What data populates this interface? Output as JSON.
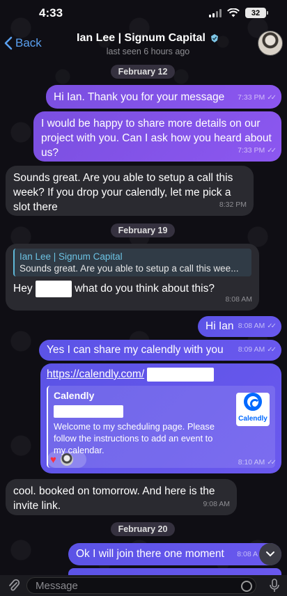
{
  "status_bar": {
    "time": "4:33",
    "battery": "32"
  },
  "header": {
    "back_label": "Back",
    "contact_name": "Ian Lee | Signum Capital",
    "last_seen": "last seen 6 hours ago"
  },
  "dates": {
    "feb12": "February 12",
    "feb19": "February 19",
    "feb20": "February 20"
  },
  "messages": [
    {
      "text": "Hi Ian. Thank you for your message",
      "time": "7:33 PM"
    },
    {
      "text": "I would be happy to share more details on our project with you. Can I ask how you heard about us?",
      "time": "7:33 PM"
    },
    {
      "text": "Sounds great. Are you able to setup a call this week? If you drop your calendly, let me pick a slot there",
      "time": "8:32 PM"
    },
    {
      "reply_name": "Ian Lee | Signum Capital",
      "reply_text": "Sounds great. Are you able to setup a call this wee...",
      "text_before": "Hey",
      "text_after": "what do you think about this?",
      "time": "8:08 AM"
    },
    {
      "text": "Hi Ian",
      "time": "8:08 AM"
    },
    {
      "text": "Yes I can share my calendly with you",
      "time": "8:09 AM"
    },
    {
      "link": "https://calendly.com/",
      "preview_site": "Calendly",
      "preview_desc": "Welcome to my scheduling page. Please follow the instructions to add an event to my calendar.",
      "logo_text": "Calendly",
      "reaction": "♥",
      "time": "8:10 AM"
    },
    {
      "text": "cool. booked on tomorrow. And here is the invite link.",
      "time": "9:08 AM"
    },
    {
      "text": "Ok I will join there one moment",
      "time": "8:08 A"
    }
  ],
  "composer": {
    "placeholder": "Message"
  },
  "colors": {
    "accent": "#5aa0f0",
    "outgoing": "#8a55ee",
    "outgoing_blue": "#5a54e8",
    "incoming": "#2a2a30",
    "reply_bar": "#5fb8d8"
  },
  "icons": [
    "chevron-left-icon",
    "verified-badge-icon",
    "attach-icon",
    "sticker-icon",
    "mic-icon",
    "chevron-down-icon",
    "read-checks-icon"
  ]
}
